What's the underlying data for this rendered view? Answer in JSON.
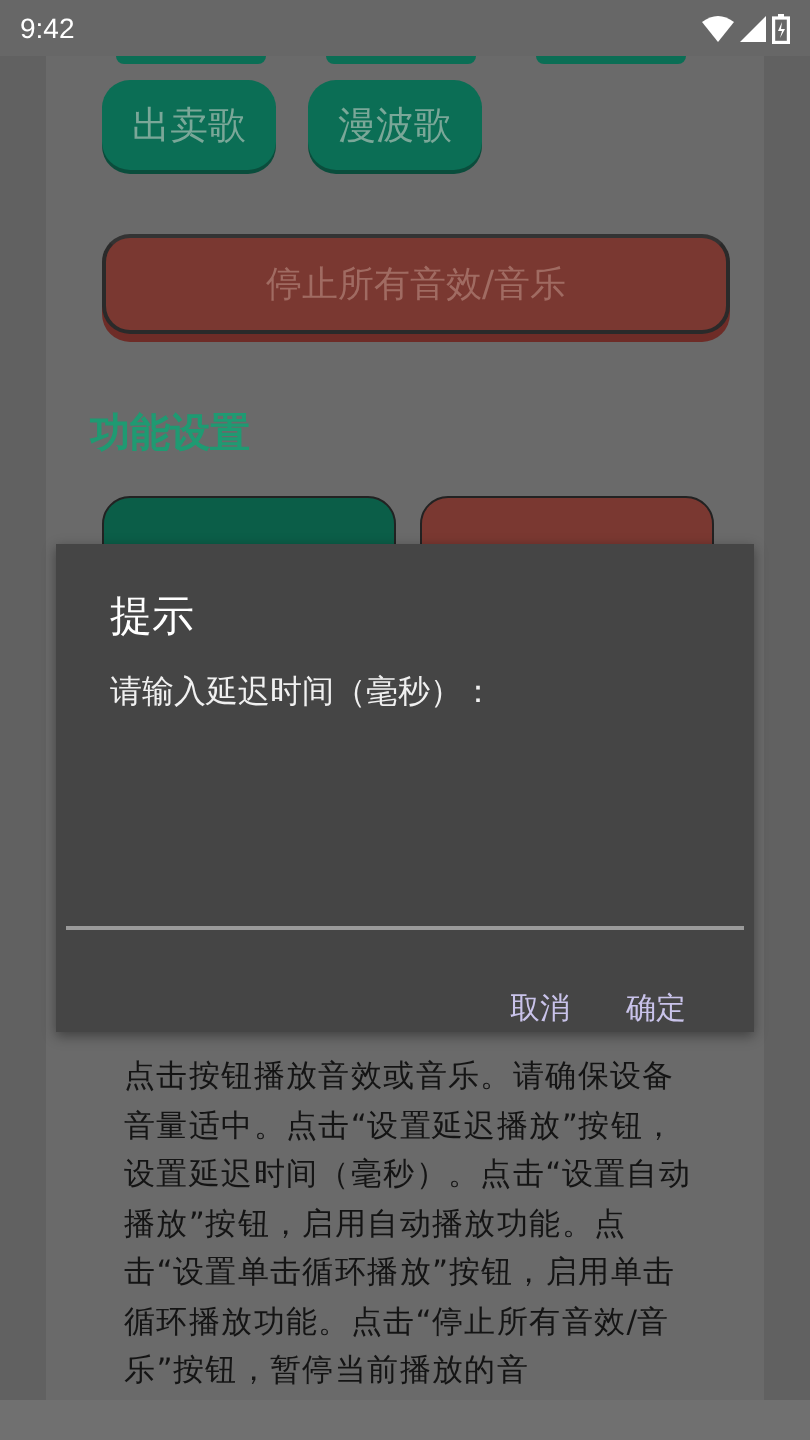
{
  "status_bar": {
    "time": "9:42"
  },
  "song_buttons": [
    {
      "label": "出卖歌"
    },
    {
      "label": "漫波歌"
    }
  ],
  "stop_button": {
    "label": "停止所有音效/音乐"
  },
  "section_title": "功能设置",
  "setting_buttons": [
    {
      "kind": "start"
    },
    {
      "kind": "cancel"
    }
  ],
  "dialog": {
    "title": "提示",
    "message": "请输入延迟时间（毫秒）：",
    "buttons": [
      "取消",
      "确定"
    ]
  },
  "instructions": "点击按钮播放音效或音乐。请确保设备音量适中。点击“设置延迟播放”按钮，设置延迟时间（毫秒）。点击“设置自动播放”按钮，启用自动播放功能。点击“设置单击循环播放”按钮，启用单击循环播放功能。点击“停止所有音效/音乐”按钮，暂停当前播放的音"
}
